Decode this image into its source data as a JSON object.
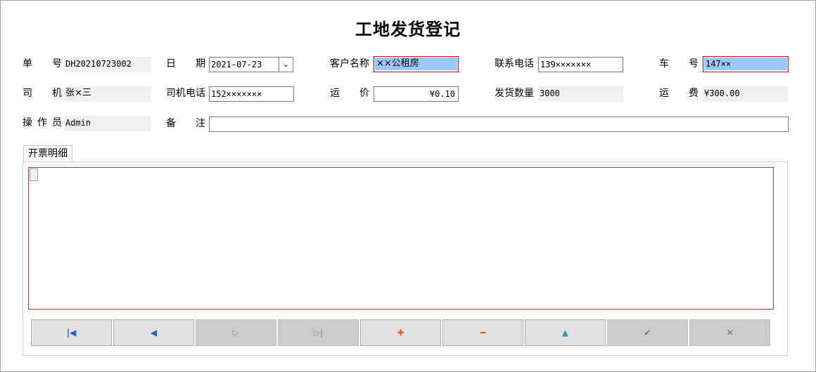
{
  "title": "工地发货登记",
  "fields": {
    "order_no": {
      "label": [
        "单",
        "号"
      ],
      "value": "DH20210723002"
    },
    "date": {
      "label": [
        "日",
        "期"
      ],
      "value": "2021-07-23"
    },
    "customer": {
      "label": "客户名称",
      "value": "××公租房"
    },
    "contact_phone": {
      "label": "联系电话",
      "value": "139×××××××"
    },
    "car_no": {
      "label": [
        "车",
        "号"
      ],
      "value": "147××"
    },
    "driver": {
      "label": [
        "司",
        "机"
      ],
      "value": "张×三"
    },
    "driver_phone": {
      "label": "司机电话",
      "value": "152×××××××"
    },
    "unit_price": {
      "label": [
        "运",
        "价"
      ],
      "value": "¥0.10"
    },
    "ship_qty": {
      "label": "发货数量",
      "value": "3000"
    },
    "freight": {
      "label": [
        "运",
        "费"
      ],
      "value": "¥300.00"
    },
    "operator": {
      "label": [
        "操",
        "作",
        "员"
      ],
      "value": "Admin"
    },
    "remark": {
      "label": [
        "备",
        "注"
      ],
      "value": ""
    }
  },
  "tab": {
    "label": "开票明细"
  },
  "navigator": {
    "buttons": [
      {
        "name": "first-record",
        "glyph": "|◀",
        "color": "#1a5fd0",
        "enabled": true
      },
      {
        "name": "prior-record",
        "glyph": "◀",
        "color": "#1a5fd0",
        "enabled": true
      },
      {
        "name": "next-record",
        "glyph": "▷",
        "color": "#909090",
        "enabled": false
      },
      {
        "name": "last-record",
        "glyph": "▷|",
        "color": "#909090",
        "enabled": false
      },
      {
        "name": "insert-record",
        "glyph": "✚",
        "color": "#e05a10",
        "enabled": true
      },
      {
        "name": "delete-record",
        "glyph": "━",
        "color": "#e05a10",
        "enabled": true
      },
      {
        "name": "edit-record",
        "glyph": "▲",
        "color": "#2aa0b0",
        "enabled": true
      },
      {
        "name": "post-record",
        "glyph": "✔",
        "color": "#707070",
        "enabled": false
      },
      {
        "name": "cancel-record",
        "glyph": "✕",
        "color": "#707070",
        "enabled": false
      }
    ]
  }
}
